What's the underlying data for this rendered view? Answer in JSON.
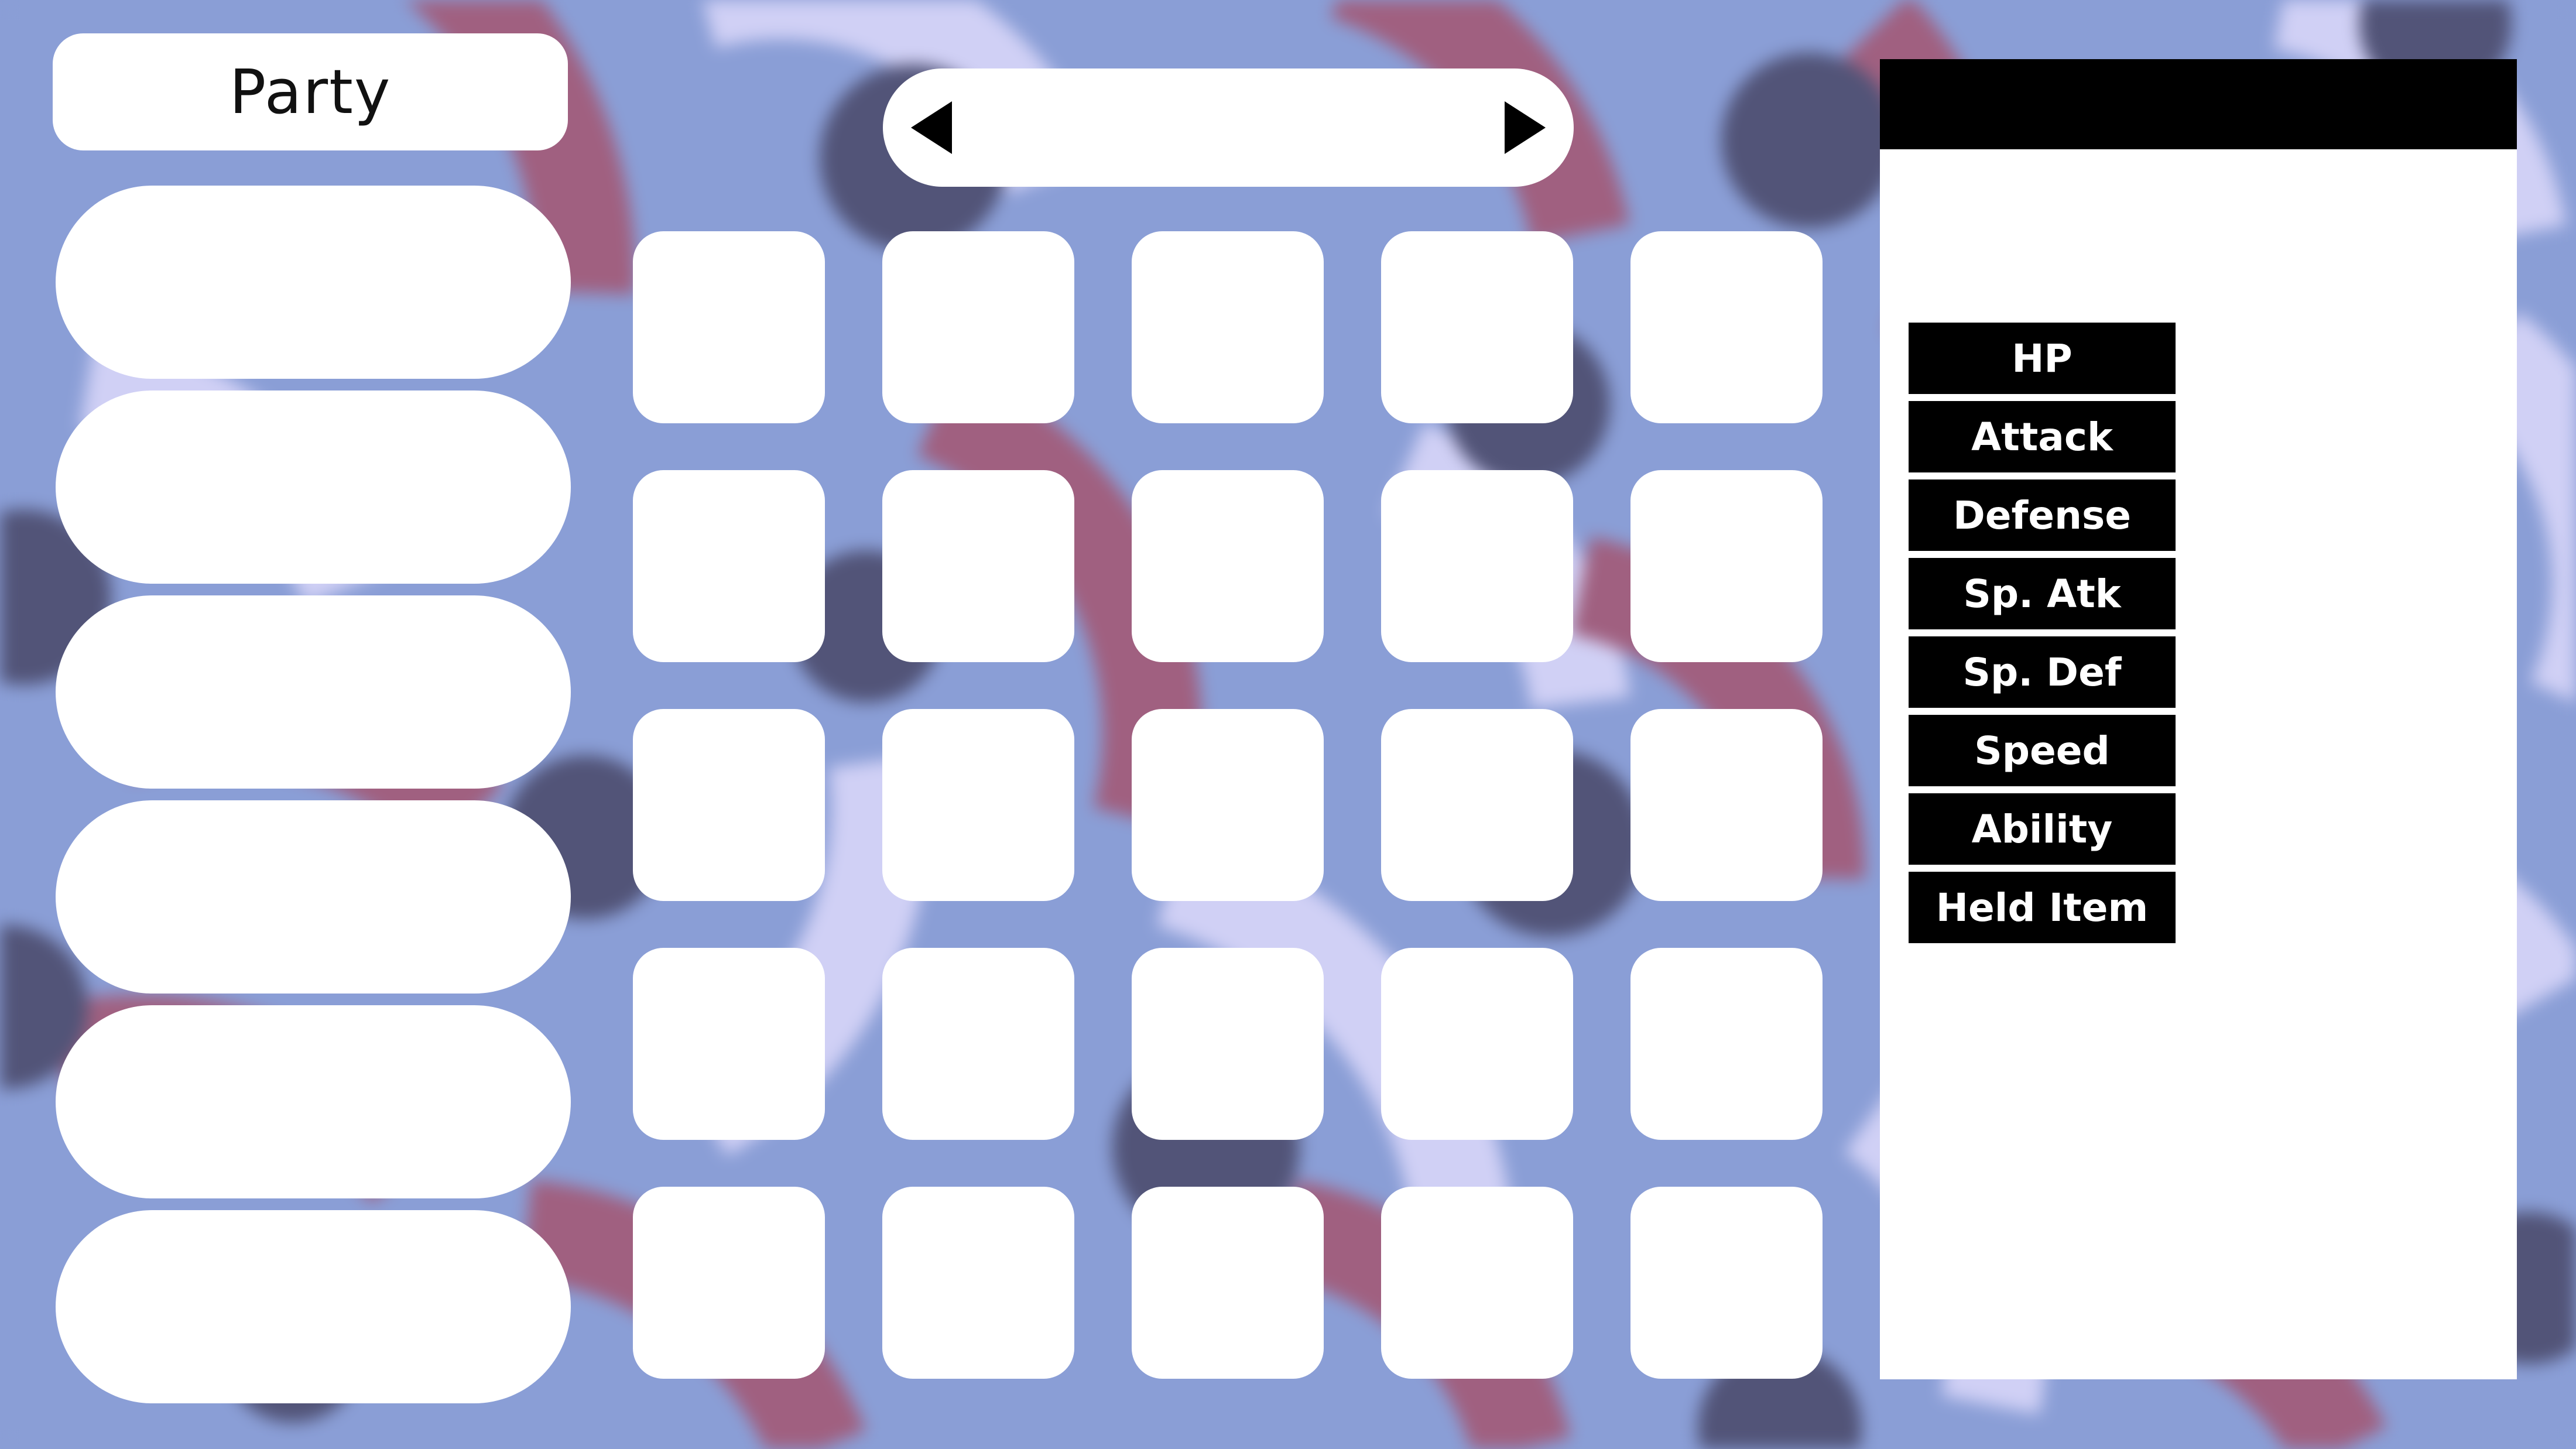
{
  "party": {
    "title": "Party",
    "slots": [
      "",
      "",
      "",
      "",
      "",
      ""
    ]
  },
  "box": {
    "name": "",
    "prev_icon": "triangle-left-icon",
    "next_icon": "triangle-right-icon",
    "rows": 5,
    "columns": 5,
    "cells": [
      "",
      "",
      "",
      "",
      "",
      "",
      "",
      "",
      "",
      "",
      "",
      "",
      "",
      "",
      "",
      "",
      "",
      "",
      "",
      "",
      "",
      "",
      "",
      "",
      ""
    ]
  },
  "summary": {
    "header": "",
    "stats": [
      {
        "label": "HP",
        "value": ""
      },
      {
        "label": "Attack",
        "value": ""
      },
      {
        "label": "Defense",
        "value": ""
      },
      {
        "label": "Sp. Atk",
        "value": ""
      },
      {
        "label": "Sp. Def",
        "value": ""
      },
      {
        "label": "Speed",
        "value": ""
      },
      {
        "label": "Ability",
        "value": ""
      },
      {
        "label": "Held Item",
        "value": ""
      }
    ]
  },
  "colors": {
    "background": "#8a9ed6",
    "pattern_pink": "#a06080",
    "pattern_lavender": "#d0d0f5",
    "pattern_navy": "#525478",
    "panel": "#ffffff",
    "label_bg": "#000000"
  }
}
